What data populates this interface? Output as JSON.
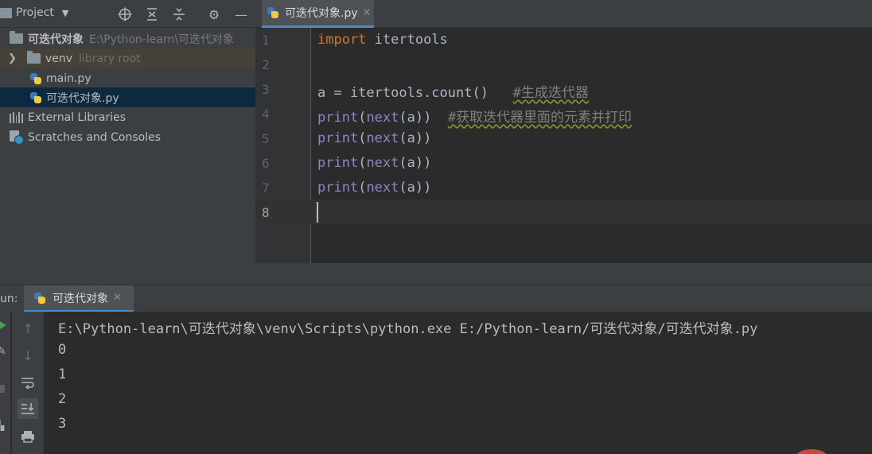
{
  "project": {
    "title": "Project",
    "tree": [
      {
        "kind": "project-root",
        "label": "可迭代对象",
        "hint": "E:\\Python-learn\\可迭代对象"
      },
      {
        "kind": "folder",
        "label": "venv",
        "hint": "library root"
      },
      {
        "kind": "python-file",
        "label": "main.py"
      },
      {
        "kind": "python-file",
        "label": "可迭代对象.py",
        "selected": true
      },
      {
        "kind": "libraries",
        "label": "External Libraries"
      },
      {
        "kind": "scratches",
        "label": "Scratches and Consoles"
      }
    ]
  },
  "editor": {
    "tab_label": "可迭代对象.py",
    "line_numbers": [
      "1",
      "2",
      "3",
      "4",
      "5",
      "6",
      "7",
      "8"
    ],
    "active_line": "8",
    "lines": {
      "l1": {
        "kw": "import",
        "rest": " itertools"
      },
      "l3": {
        "code": "a = itertools.count()   ",
        "comment": "#生成迭代器"
      },
      "l4": {
        "fn": "print",
        "p1": "(",
        "fn2": "next",
        "p2": "(a))  ",
        "comment": "#获取迭代器里面的元素并打印"
      },
      "l5": {
        "fn": "print",
        "p1": "(",
        "fn2": "next",
        "p2": "(a))"
      },
      "l6": {
        "fn": "print",
        "p1": "(",
        "fn2": "next",
        "p2": "(a))"
      },
      "l7": {
        "fn": "print",
        "p1": "(",
        "fn2": "next",
        "p2": "(a))"
      }
    }
  },
  "run": {
    "label": "un:",
    "tab_label": "可迭代对象",
    "output": [
      "E:\\Python-learn\\可迭代对象\\venv\\Scripts\\python.exe E:/Python-learn/可迭代对象/可迭代对象.py",
      "0",
      "1",
      "2",
      "3"
    ]
  },
  "colors": {
    "keyword": "#cc7832",
    "builtin": "#8888c6",
    "comment": "#808080",
    "selection": "#0d293e",
    "accent": "#4a88c7"
  }
}
